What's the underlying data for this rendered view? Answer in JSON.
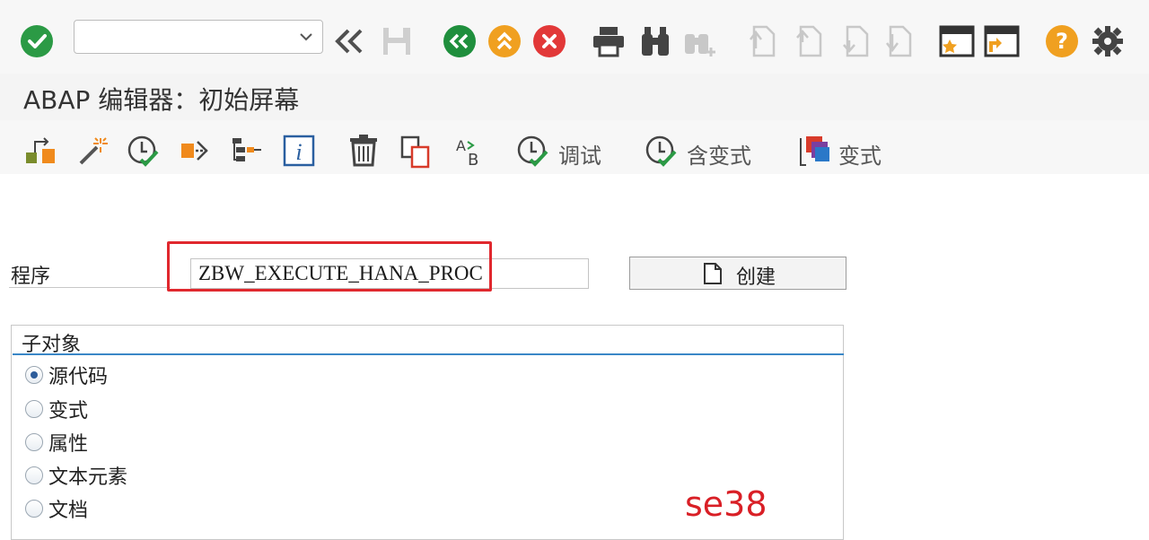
{
  "window": {
    "title": "ABAP 编辑器：初始屏幕"
  },
  "toolbar": {
    "command_field": {
      "value": "",
      "placeholder": ""
    },
    "buttons": [
      "enter-icon",
      "back-arrows-icon",
      "save-icon",
      "back-icon",
      "exit-icon",
      "cancel-icon",
      "print-icon",
      "find-icon",
      "find-next-icon",
      "first-page-icon",
      "prev-page-icon",
      "next-page-icon",
      "last-page-icon",
      "new-session-icon",
      "shortcut-icon",
      "help-icon",
      "settings-icon"
    ]
  },
  "app_toolbar": {
    "debug_label": "调试",
    "debug_with_variant_label": "含变式",
    "variants_label": "变式"
  },
  "program": {
    "label": "程序",
    "value": "ZBW_EXECUTE_HANA_PROC",
    "create_label": "创建"
  },
  "subobjects": {
    "title": "子对象",
    "options": [
      {
        "label": "源代码",
        "selected": true
      },
      {
        "label": "变式",
        "selected": false
      },
      {
        "label": "属性",
        "selected": false
      },
      {
        "label": "文本元素",
        "selected": false
      },
      {
        "label": "文档",
        "selected": false
      }
    ]
  },
  "annotation": "se38",
  "colors": {
    "accent_green": "#2b9a45",
    "accent_orange": "#f0a020",
    "accent_red": "#e23838",
    "highlight_red": "#e0282e",
    "group_line_blue": "#3a87c7"
  }
}
